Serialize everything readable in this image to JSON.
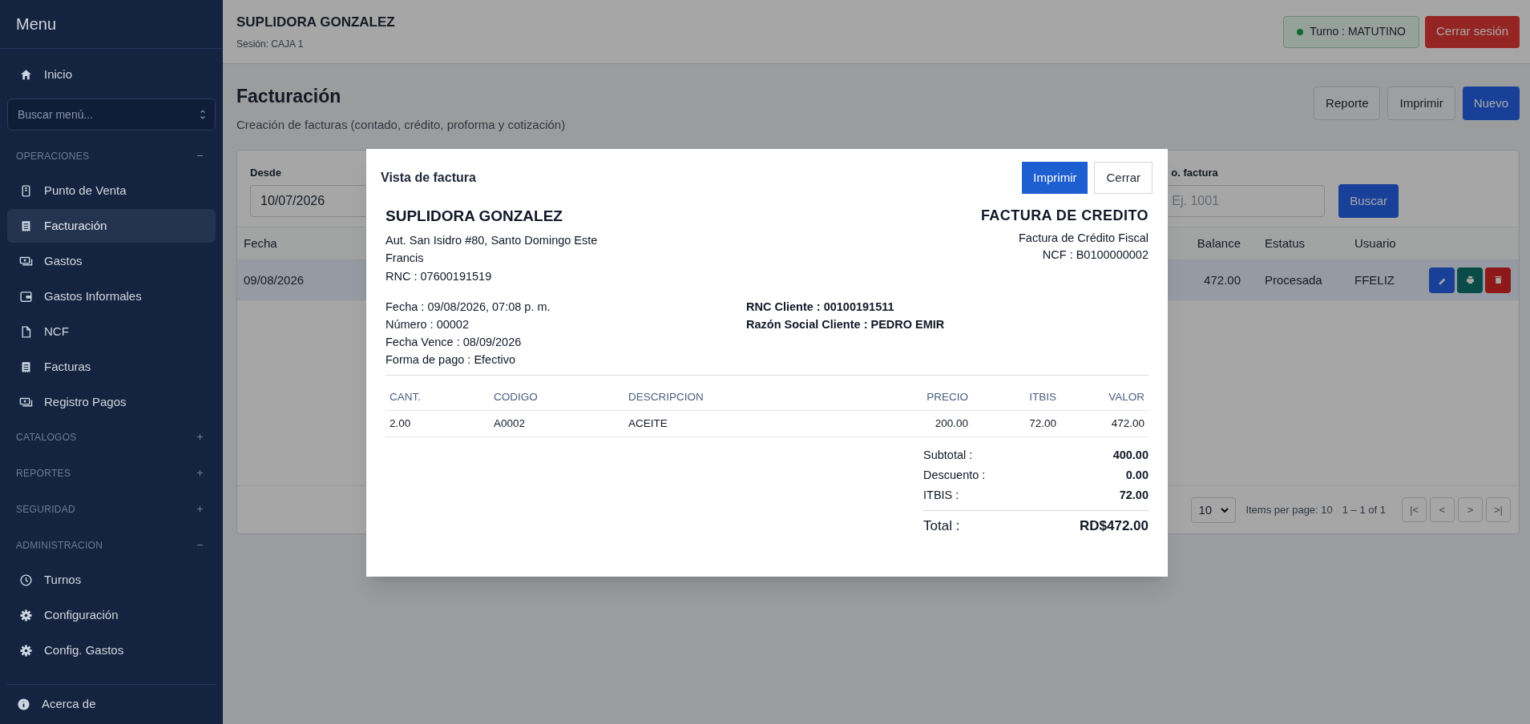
{
  "sidebar": {
    "title": "Menu",
    "home": {
      "label": "Inicio",
      "selected": false
    },
    "search": {
      "placeholder": "Buscar menú..."
    },
    "sections": [
      {
        "label": "OPERACIONES",
        "expanded": true,
        "items": [
          {
            "label": "Punto de Venta",
            "selected": false
          },
          {
            "label": "Facturación",
            "selected": true
          },
          {
            "label": "Gastos",
            "selected": false
          },
          {
            "label": "Gastos Informales",
            "selected": false
          },
          {
            "label": "NCF",
            "selected": false
          },
          {
            "label": "Facturas",
            "selected": false
          },
          {
            "label": "Registro Pagos",
            "selected": false
          }
        ]
      },
      {
        "label": "CATALOGOS",
        "expanded": false
      },
      {
        "label": "REPORTES",
        "expanded": false
      },
      {
        "label": "SEGURIDAD",
        "expanded": false
      },
      {
        "label": "ADMINISTRACION",
        "expanded": true,
        "items": [
          {
            "label": "Turnos",
            "selected": false
          },
          {
            "label": "Configuración",
            "selected": false
          },
          {
            "label": "Config. Gastos",
            "selected": false
          }
        ]
      }
    ],
    "footer": {
      "label": "Acerca de"
    }
  },
  "header": {
    "company": "SUPLIDORA GONZALEZ",
    "session": "Sesión: CAJA 1",
    "shift": "Turno : MATUTINO",
    "logout": "Cerrar sesión"
  },
  "page": {
    "title": "Facturación",
    "subtitle": "Creación de facturas (contado, crédito, proforma y cotización)",
    "buttons": [
      "Reporte",
      "Imprimir",
      "Nuevo"
    ]
  },
  "filters": {
    "from": {
      "label": "Desde",
      "value": "10/07/2026"
    },
    "number": {
      "label": "o. factura",
      "placeholder": "Ej. 1001"
    },
    "search_button": "Buscar"
  },
  "table": {
    "columns": [
      "Fecha",
      "Balance",
      "Estatus",
      "Usuario"
    ],
    "rows": [
      {
        "cells": [
          "09/08/2026",
          "472.00",
          "Procesada",
          "FFELIZ"
        ],
        "selected": true
      }
    ]
  },
  "pagination": {
    "page_size": "10",
    "label": "Items per page: 10",
    "range": "1 – 1 of 1",
    "nav": [
      "|<",
      "<",
      ">",
      ">|"
    ]
  },
  "modal": {
    "title": "Vista de factura",
    "buttons": [
      "Imprimir",
      "Cerrar"
    ],
    "company": {
      "name": "SUPLIDORA GONZALEZ",
      "lines": [
        "Aut. San Isidro #80, Santo Domingo Este",
        "Francis",
        "RNC : 07600191519"
      ]
    },
    "document": {
      "title": "FACTURA DE CREDITO",
      "lines": [
        "Factura de Crédito Fiscal",
        "NCF : B0100000002"
      ]
    },
    "info_left": [
      "Fecha : 09/08/2026, 07:08 p. m.",
      "Número : 00002",
      "Fecha Vence : 08/09/2026",
      "Forma de pago : Efectivo"
    ],
    "info_right": [
      "RNC Cliente : 00100191511",
      "Razón Social Cliente : PEDRO EMIR"
    ],
    "items": {
      "columns": [
        "CANT.",
        "CODIGO",
        "DESCRIPCION",
        "PRECIO",
        "ITBIS",
        "VALOR"
      ],
      "rows": [
        [
          "2.00",
          "A0002",
          "ACEITE",
          "200.00",
          "72.00",
          "472.00"
        ]
      ]
    },
    "totals": [
      {
        "label": "Subtotal :",
        "value": "400.00"
      },
      {
        "label": "Descuento :",
        "value": "0.00"
      },
      {
        "label": "ITBIS :",
        "value": "72.00"
      }
    ],
    "total": {
      "label": "Total :",
      "value": "RD$472.00"
    }
  }
}
